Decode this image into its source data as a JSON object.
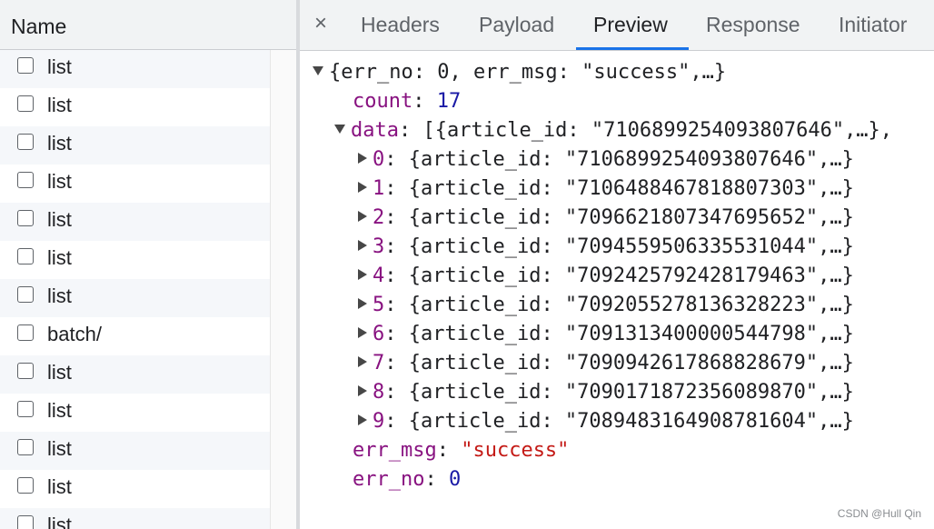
{
  "left": {
    "header": "Name",
    "rows": [
      "list",
      "list",
      "list",
      "list",
      "list",
      "list",
      "list",
      "batch/",
      "list",
      "list",
      "list",
      "list",
      "list"
    ]
  },
  "tabs": {
    "close": "×",
    "items": [
      "Headers",
      "Payload",
      "Preview",
      "Response",
      "Initiator"
    ],
    "active": "Preview"
  },
  "preview": {
    "root_summary": "{err_no: 0, err_msg: \"success\",…}",
    "count_key": "count",
    "count_value": "17",
    "data_key": "data",
    "data_summary": "[{article_id: \"7106899254093807646\",…},",
    "items": [
      {
        "index": "0",
        "summary": "{article_id: \"7106899254093807646\",…}"
      },
      {
        "index": "1",
        "summary": "{article_id: \"7106488467818807303\",…}"
      },
      {
        "index": "2",
        "summary": "{article_id: \"7096621807347695652\",…}"
      },
      {
        "index": "3",
        "summary": "{article_id: \"7094559506335531044\",…}"
      },
      {
        "index": "4",
        "summary": "{article_id: \"7092425792428179463\",…}"
      },
      {
        "index": "5",
        "summary": "{article_id: \"7092055278136328223\",…}"
      },
      {
        "index": "6",
        "summary": "{article_id: \"7091313400000544798\",…}"
      },
      {
        "index": "7",
        "summary": "{article_id: \"7090942617868828679\",…}"
      },
      {
        "index": "8",
        "summary": "{article_id: \"7090171872356089870\",…}"
      },
      {
        "index": "9",
        "summary": "{article_id: \"7089483164908781604\",…}"
      }
    ],
    "err_msg_key": "err_msg",
    "err_msg_value": "\"success\"",
    "err_no_key": "err_no",
    "err_no_value": "0"
  },
  "watermark": "CSDN @Hull Qin",
  "colors": {
    "accent": "#1a73e8",
    "key": "#881280",
    "number": "#1a1aa6",
    "string": "#c41a16"
  }
}
